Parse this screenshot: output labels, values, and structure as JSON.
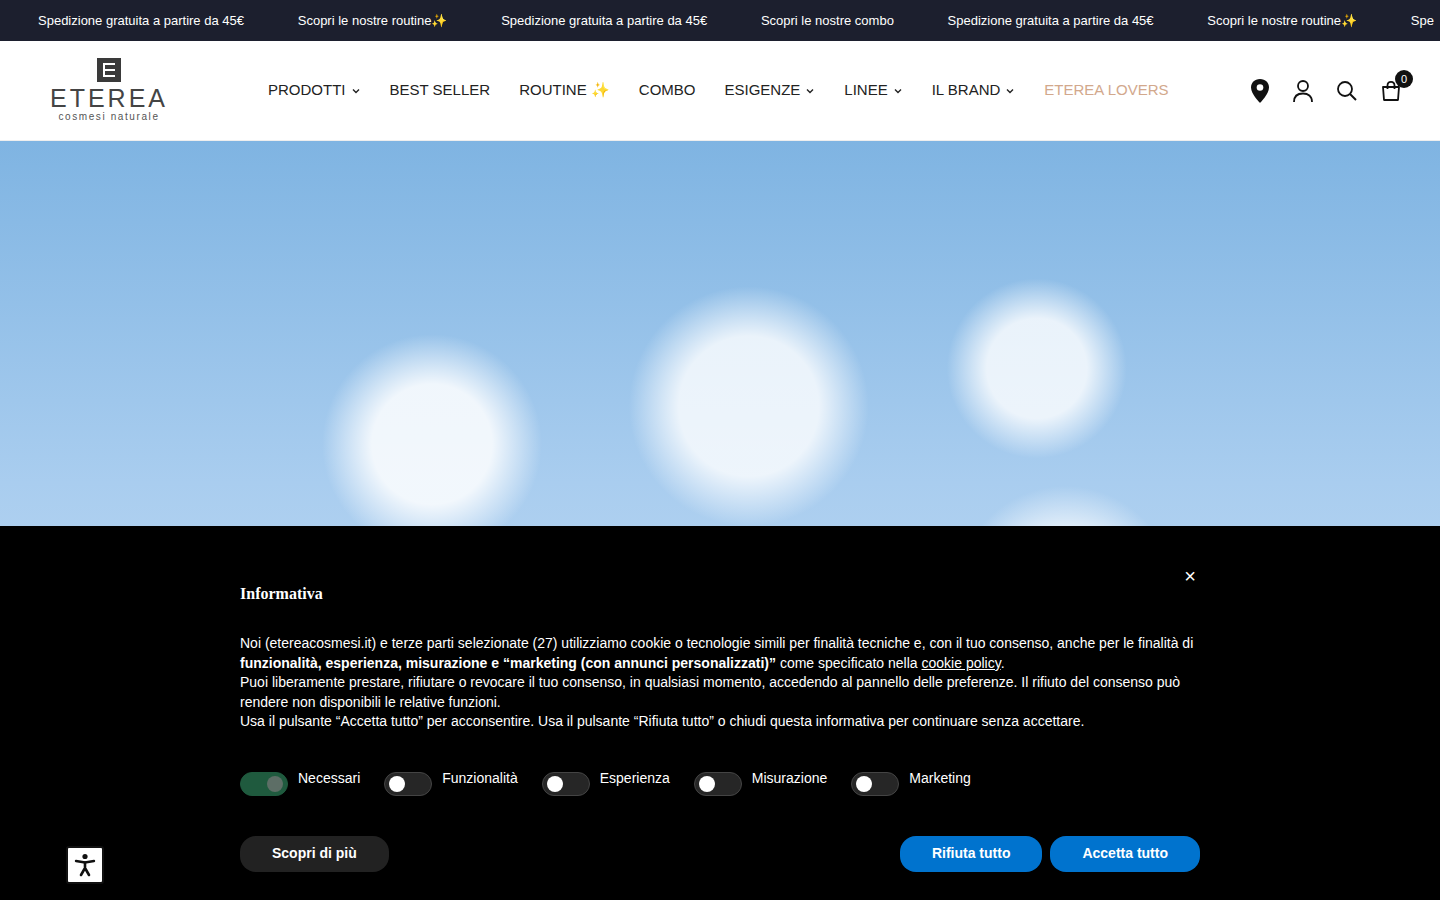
{
  "announcement_bar": {
    "items": [
      "Spedizione gratuita a partire da 45€",
      "Scopri le nostre routine✨",
      "Spedizione gratuita a partire da 45€",
      "Scopri le nostre combo",
      "Spedizione gratuita a partire da 45€",
      "Scopri le nostre routine✨",
      "Spe"
    ]
  },
  "header": {
    "logo": {
      "wordmark": "ETEREA",
      "tagline": "cosmesi naturale"
    },
    "nav": [
      {
        "label": "PRODOTTI",
        "has_dropdown": true,
        "color": "#222222"
      },
      {
        "label": "BEST SELLER",
        "has_dropdown": false,
        "color": "#222222"
      },
      {
        "label": "ROUTINE ✨",
        "has_dropdown": false,
        "color": "#222222"
      },
      {
        "label": "COMBO",
        "has_dropdown": false,
        "color": "#222222"
      },
      {
        "label": "ESIGENZE",
        "has_dropdown": true,
        "color": "#222222"
      },
      {
        "label": "LINEE",
        "has_dropdown": true,
        "color": "#222222"
      },
      {
        "label": "IL BRAND",
        "has_dropdown": true,
        "color": "#222222"
      },
      {
        "label": "ETEREA LOVERS",
        "has_dropdown": false,
        "color": "#d2a88c"
      }
    ],
    "cart": {
      "count": "0"
    }
  },
  "cookie_banner": {
    "title": "Informativa",
    "close": "×",
    "intro": [
      {
        "kind": "plain",
        "text": "Noi (etereacosmesi.it) e terze parti selezionate (27) utilizziamo cookie o tecnologie simili per finalità tecniche e, con il tuo consenso, anche per le finalità di "
      },
      {
        "kind": "bold",
        "text": "funzionalità, esperienza, misurazione e “marketing (con annunci personalizzati)”"
      },
      {
        "kind": "plain",
        "text": " come specificato nella "
      },
      {
        "kind": "link",
        "text": "cookie policy"
      },
      {
        "kind": "plain",
        "text": "."
      }
    ],
    "paragraphs": [
      "Puoi liberamente prestare, rifiutare o revocare il tuo consenso, in qualsiasi momento, accedendo al pannello delle preferenze. Il rifiuto del consenso può rendere non disponibili le relative funzioni.",
      "Usa il pulsante “Accetta tutto” per acconsentire. Usa il pulsante “Rifiuta tutto” o chiudi questa informativa per continuare senza accettare."
    ],
    "toggles": [
      {
        "label": "Necessari",
        "on": true,
        "disabled": true
      },
      {
        "label": "Funzionalità",
        "on": false,
        "disabled": false
      },
      {
        "label": "Esperienza",
        "on": false,
        "disabled": false
      },
      {
        "label": "Misurazione",
        "on": false,
        "disabled": false
      },
      {
        "label": "Marketing",
        "on": false,
        "disabled": false
      }
    ],
    "buttons": [
      {
        "label": "Scopri di più",
        "kind": "secondary"
      },
      {
        "label": "Rifiuta tutto",
        "kind": "primary"
      },
      {
        "label": "Accetta tutto",
        "kind": "primary"
      }
    ]
  }
}
